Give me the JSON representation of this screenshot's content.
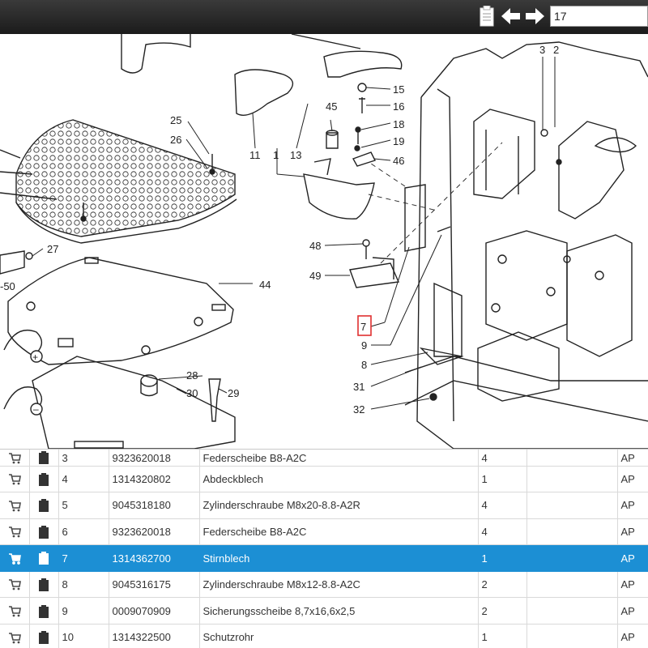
{
  "toolbar": {
    "search_value": "17",
    "icons": [
      "clipboard-icon",
      "arrow-left-icon",
      "arrow-right-icon"
    ]
  },
  "callouts": {
    "c1": "1",
    "c2": "2",
    "c3": "3",
    "c7": "7",
    "c8": "8",
    "c9": "9",
    "c11": "11",
    "c13": "13",
    "c15": "15",
    "c16": "16",
    "c18": "18",
    "c19": "19",
    "c25": "25",
    "c26": "26",
    "c27": "27",
    "c28": "28",
    "c29": "29",
    "c30": "30",
    "c31": "31",
    "c32": "32",
    "c44": "44",
    "c45": "45",
    "c46": "46",
    "c48": "48",
    "c49": "49",
    "c50": "-50"
  },
  "parts": {
    "rows": [
      {
        "pos": "3",
        "number": "9323620018",
        "desc": "Federscheibe B8-A2C",
        "qty": "4",
        "unit": "AP"
      },
      {
        "pos": "4",
        "number": "1314320802",
        "desc": "Abdeckblech",
        "qty": "1",
        "unit": "AP"
      },
      {
        "pos": "5",
        "number": "9045318180",
        "desc": "Zylinderschraube M8x20-8.8-A2R",
        "qty": "4",
        "unit": "AP"
      },
      {
        "pos": "6",
        "number": "9323620018",
        "desc": "Federscheibe B8-A2C",
        "qty": "4",
        "unit": "AP"
      },
      {
        "pos": "7",
        "number": "1314362700",
        "desc": "Stirnblech",
        "qty": "1",
        "unit": "AP"
      },
      {
        "pos": "8",
        "number": "9045316175",
        "desc": "Zylinderschraube M8x12-8.8-A2C",
        "qty": "2",
        "unit": "AP"
      },
      {
        "pos": "9",
        "number": "0009070909",
        "desc": "Sicherungsscheibe 8,7x16,6x2,5",
        "qty": "2",
        "unit": "AP"
      },
      {
        "pos": "10",
        "number": "1314322500",
        "desc": "Schutzrohr",
        "qty": "1",
        "unit": "AP"
      }
    ]
  },
  "colors": {
    "selected_row": "#1c8fd4",
    "highlight_box": "#e03030",
    "toolbar": "#2a2a2a"
  }
}
